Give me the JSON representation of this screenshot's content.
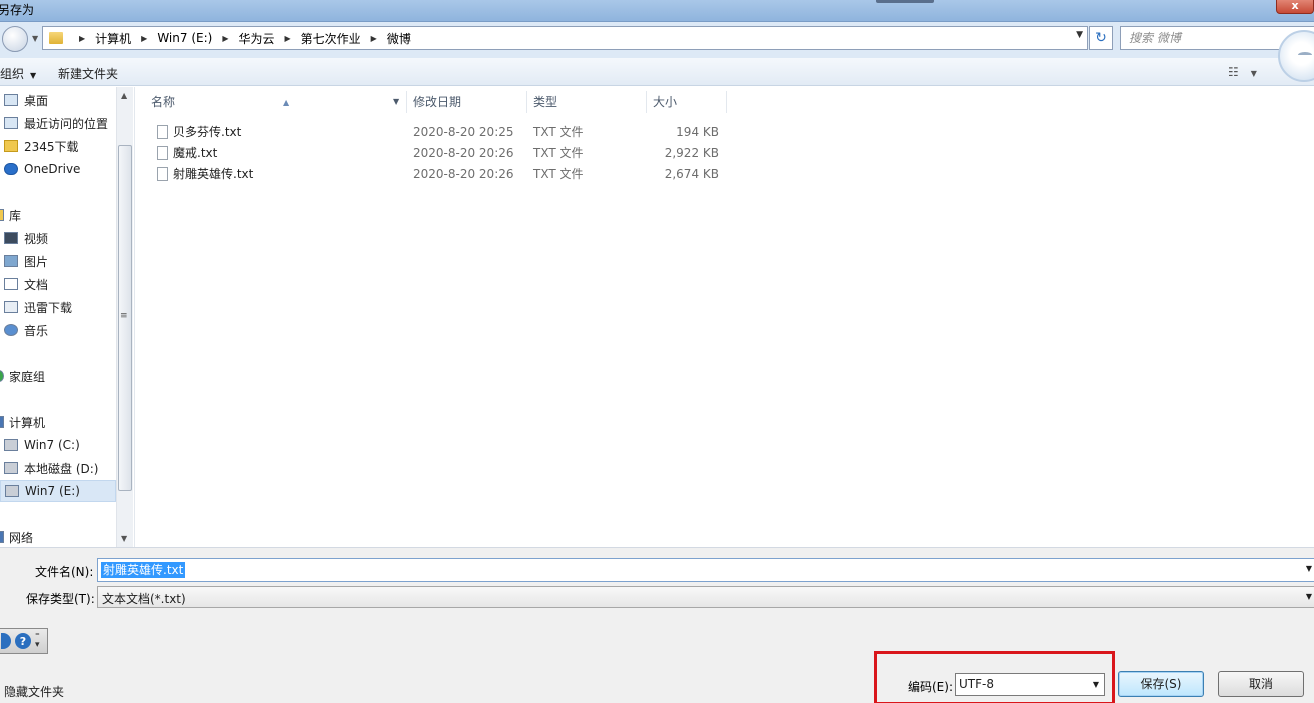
{
  "window": {
    "title": "另存为",
    "close_label": "x"
  },
  "address": {
    "crumbs": [
      "计算机",
      "Win7 (E:)",
      "华为云",
      "第七次作业",
      "微博"
    ],
    "search_placeholder": "搜索 微博",
    "refresh_icon": "↻"
  },
  "toolbar": {
    "organize": "组织",
    "new_folder": "新建文件夹",
    "view_icon": "☷"
  },
  "nav": {
    "items": [
      {
        "label": "桌面",
        "icon": "desktop-icon"
      },
      {
        "label": "最近访问的位置",
        "icon": "recent-icon"
      },
      {
        "label": "2345下载",
        "icon": "folder-icon"
      },
      {
        "label": "OneDrive",
        "icon": "cloud-icon"
      },
      {
        "label": "库",
        "icon": "library-icon"
      },
      {
        "label": "视频",
        "icon": "video-icon"
      },
      {
        "label": "图片",
        "icon": "picture-icon"
      },
      {
        "label": "文档",
        "icon": "document-icon"
      },
      {
        "label": "迅雷下载",
        "icon": "download-icon"
      },
      {
        "label": "音乐",
        "icon": "music-icon"
      },
      {
        "label": "家庭组",
        "icon": "homegroup-icon"
      },
      {
        "label": "计算机",
        "icon": "computer-icon"
      },
      {
        "label": "Win7 (C:)",
        "icon": "drive-icon"
      },
      {
        "label": "本地磁盘 (D:)",
        "icon": "drive-icon"
      },
      {
        "label": "Win7 (E:)",
        "icon": "drive-icon",
        "selected": true
      },
      {
        "label": "网络",
        "icon": "network-icon"
      }
    ]
  },
  "filelist": {
    "columns": [
      "名称",
      "修改日期",
      "类型",
      "大小"
    ],
    "rows": [
      {
        "name": "贝多芬传.txt",
        "date": "2020-8-20 20:25",
        "type": "TXT 文件",
        "size": "194 KB"
      },
      {
        "name": "魔戒.txt",
        "date": "2020-8-20 20:26",
        "type": "TXT 文件",
        "size": "2,922 KB"
      },
      {
        "name": "射雕英雄传.txt",
        "date": "2020-8-20 20:26",
        "type": "TXT 文件",
        "size": "2,674 KB"
      }
    ]
  },
  "form": {
    "filename_label": "文件名(N):",
    "filename_value": "射雕英雄传.txt",
    "filetype_label": "保存类型(T):",
    "filetype_value": "文本文档(*.txt)",
    "encoding_label": "编码(E):",
    "encoding_value": "UTF-8",
    "hide_folders": "隐藏文件夹",
    "save_button": "保存(S)",
    "cancel_button": "取消",
    "help_icon": "?"
  },
  "colors": {
    "highlight_box": "#d9161b",
    "selection": "#3399ff"
  }
}
